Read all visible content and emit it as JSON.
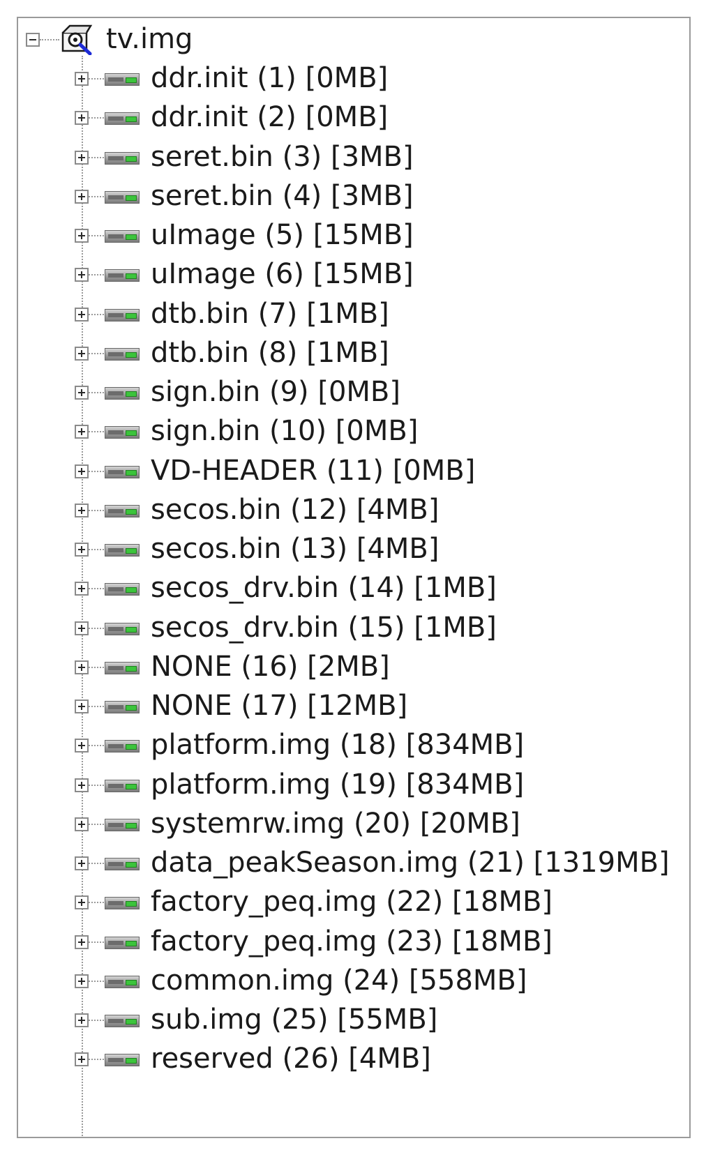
{
  "tree": {
    "root": {
      "label": "tv.img",
      "icon": "disk-image-search-icon",
      "expanded": true
    },
    "items": [
      {
        "label": "ddr.init (1) [0MB]",
        "icon": "drive-icon"
      },
      {
        "label": "ddr.init (2) [0MB]",
        "icon": "drive-icon"
      },
      {
        "label": "seret.bin (3) [3MB]",
        "icon": "drive-icon"
      },
      {
        "label": "seret.bin (4) [3MB]",
        "icon": "drive-icon"
      },
      {
        "label": "uImage (5) [15MB]",
        "icon": "drive-icon"
      },
      {
        "label": "uImage (6) [15MB]",
        "icon": "drive-icon"
      },
      {
        "label": "dtb.bin (7) [1MB]",
        "icon": "drive-icon"
      },
      {
        "label": "dtb.bin (8) [1MB]",
        "icon": "drive-icon"
      },
      {
        "label": "sign.bin (9) [0MB]",
        "icon": "drive-icon"
      },
      {
        "label": "sign.bin (10) [0MB]",
        "icon": "drive-icon"
      },
      {
        "label": "VD-HEADER (11) [0MB]",
        "icon": "drive-icon"
      },
      {
        "label": "secos.bin (12) [4MB]",
        "icon": "drive-icon"
      },
      {
        "label": "secos.bin (13) [4MB]",
        "icon": "drive-icon"
      },
      {
        "label": "secos_drv.bin (14) [1MB]",
        "icon": "drive-icon"
      },
      {
        "label": "secos_drv.bin (15) [1MB]",
        "icon": "drive-icon"
      },
      {
        "label": "NONE (16) [2MB]",
        "icon": "drive-icon"
      },
      {
        "label": "NONE (17) [12MB]",
        "icon": "drive-icon"
      },
      {
        "label": "platform.img (18) [834MB]",
        "icon": "drive-icon"
      },
      {
        "label": "platform.img (19) [834MB]",
        "icon": "drive-icon"
      },
      {
        "label": "systemrw.img (20) [20MB]",
        "icon": "drive-icon"
      },
      {
        "label": "data_peakSeason.img (21) [1319MB]",
        "icon": "drive-icon"
      },
      {
        "label": "factory_peq.img (22) [18MB]",
        "icon": "drive-icon"
      },
      {
        "label": "factory_peq.img (23) [18MB]",
        "icon": "drive-icon"
      },
      {
        "label": "common.img (24) [558MB]",
        "icon": "drive-icon"
      },
      {
        "label": "sub.img (25) [55MB]",
        "icon": "drive-icon"
      },
      {
        "label": "reserved (26) [4MB]",
        "icon": "drive-icon"
      }
    ]
  },
  "colors": {
    "border": "#9a9a9a",
    "text": "#1a1a1a",
    "led": "#3cc43c",
    "root_icon_accent": "#1d2bd6"
  }
}
